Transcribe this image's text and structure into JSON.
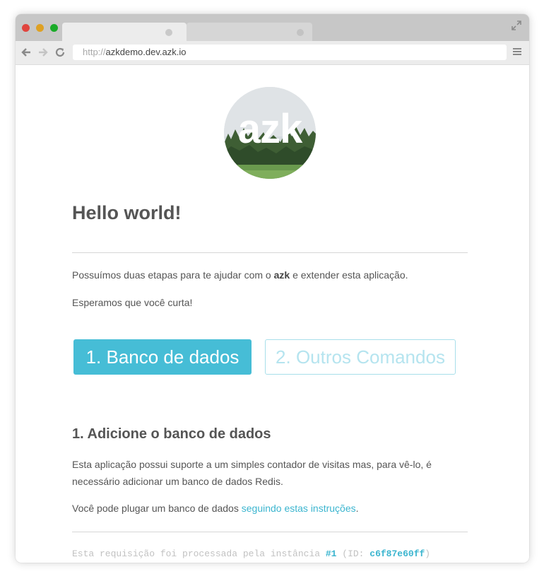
{
  "browser": {
    "url_protocol": "http://",
    "url_host": "azkdemo.dev.azk.io",
    "colors": {
      "titlebar": "#c7c7c7",
      "toolbar": "#ececec"
    }
  },
  "logo": {
    "text": "azk"
  },
  "page": {
    "title": "Hello world!",
    "intro_before": "Possuímos duas etapas para te ajudar com o ",
    "intro_bold": "azk",
    "intro_after": " e extender esta aplicação.",
    "enjoy": "Esperamos que você curta!"
  },
  "steps": {
    "step1_label": "1. Banco de dados",
    "step2_label": "2. Outros Comandos"
  },
  "section": {
    "title": "1. Adicione o banco de dados",
    "description": "Esta aplicação possui suporte a um simples contador de visitas mas, para vê-lo, é necessário adicionar um banco de dados Redis.",
    "plug_before": "Você pode plugar um banco de dados ",
    "plug_link": "seguindo estas instruções",
    "plug_after": "."
  },
  "footer": {
    "prefix": "Esta requisição foi processada pela instância ",
    "instance": "#1",
    "id_prefix": " (ID: ",
    "id": "c6f87e60ff",
    "id_suffix": ")"
  },
  "colors": {
    "accent": "#46bdd6",
    "link": "#3bb5cf",
    "text": "#555555"
  }
}
